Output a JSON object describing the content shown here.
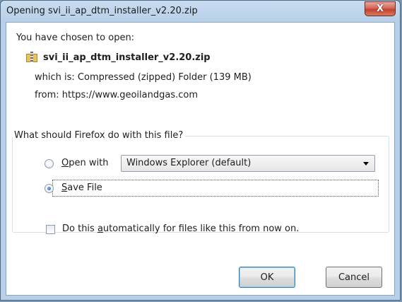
{
  "window": {
    "title": "Opening svi_ii_ap_dtm_installer_v2.20.zip"
  },
  "titlebar": {
    "close_glyph": "X"
  },
  "dialog": {
    "chosen_text": "You have chosen to open:",
    "filename": "svi_ii_ap_dtm_installer_v2.20.zip",
    "which_is_label": "which is:",
    "which_is_value": "Compressed (zipped) Folder (139 MB)",
    "from_label": "from:",
    "from_value": "https://www.geoilandgas.com"
  },
  "action_group": {
    "legend": "What should Firefox do with this file?",
    "open_with_prefix": "",
    "open_with_access": "O",
    "open_with_rest": "pen with",
    "open_with_selected": "Windows Explorer (default)",
    "save_access": "S",
    "save_rest": "ave File",
    "selected_option": "save_file",
    "auto_prefix": "Do this ",
    "auto_access": "a",
    "auto_rest": "utomatically for files like this from now on.",
    "auto_checked": false
  },
  "buttons": {
    "ok": "OK",
    "cancel": "Cancel"
  },
  "icons": {
    "file": "zip-folder-icon",
    "close": "close-icon",
    "dropdown": "chevron-down-icon"
  }
}
